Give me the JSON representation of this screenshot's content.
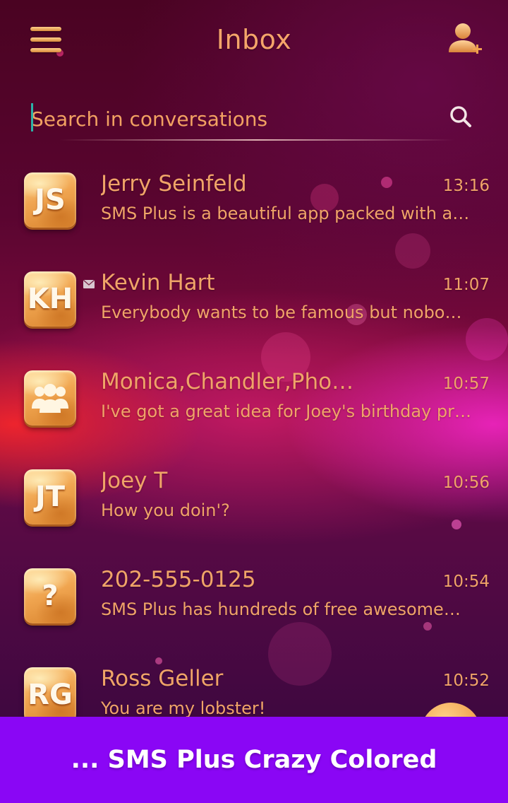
{
  "header": {
    "title": "Inbox",
    "menu_icon": "hamburger-menu-icon",
    "add_contact_icon": "add-contact-icon"
  },
  "search": {
    "placeholder": "Search in conversations",
    "icon": "search-icon"
  },
  "conversations": [
    {
      "initials": "JS",
      "name": "Jerry Seinfeld",
      "time": "13:16",
      "preview": "SMS Plus is a beautiful app packed with a…",
      "unread": false,
      "avatar_type": "initials"
    },
    {
      "initials": "KH",
      "name": "Kevin Hart",
      "time": "11:07",
      "preview": "Everybody wants to be famous but nobo…",
      "unread": true,
      "avatar_type": "initials"
    },
    {
      "initials": "",
      "name": "Monica,Chandler,Pho…",
      "time": "10:57",
      "preview": "I've got a great idea for Joey's birthday pr…",
      "unread": false,
      "avatar_type": "group-icon"
    },
    {
      "initials": "JT",
      "name": "Joey T",
      "time": "10:56",
      "preview": "How you doin'?",
      "unread": false,
      "avatar_type": "initials"
    },
    {
      "initials": "?",
      "name": "202-555-0125",
      "time": "10:54",
      "preview": "SMS Plus has hundreds of free awesome…",
      "unread": false,
      "avatar_type": "initials"
    },
    {
      "initials": "RG",
      "name": "Ross Geller",
      "time": "10:52",
      "preview": " You are my lobster!",
      "unread": false,
      "avatar_type": "initials"
    }
  ],
  "banner": {
    "text": "... SMS Plus Crazy Colored",
    "color": "#8a06f5"
  },
  "colors": {
    "accent": "#f0a468",
    "background": "#5a0530"
  }
}
